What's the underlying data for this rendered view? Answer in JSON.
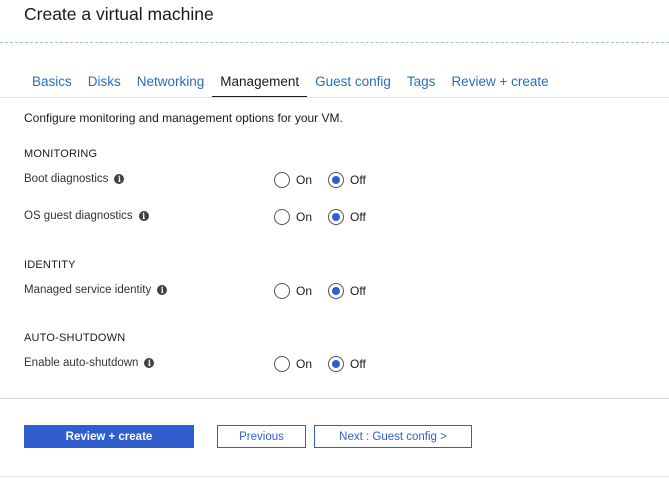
{
  "page_title": "Create a virtual machine",
  "tabs": [
    "Basics",
    "Disks",
    "Networking",
    "Management",
    "Guest config",
    "Tags",
    "Review + create"
  ],
  "intro": "Configure monitoring and management options for your VM.",
  "sections": {
    "monitoring": "MONITORING",
    "identity": "IDENTITY",
    "autoshutdown": "AUTO-SHUTDOWN"
  },
  "rows": [
    {
      "label": "Boot diagnostics",
      "on": "On",
      "off": "Off",
      "selected": "Off"
    },
    {
      "label": "OS guest diagnostics",
      "on": "On",
      "off": "Off",
      "selected": "Off"
    },
    {
      "label": "Managed service identity",
      "on": "On",
      "off": "Off",
      "selected": "Off"
    },
    {
      "label": "Enable auto-shutdown",
      "on": "On",
      "off": "Off",
      "selected": "Off"
    }
  ],
  "info_glyph": "i",
  "buttons": {
    "review_create": "Review + create",
    "previous": "Previous",
    "next": "Next : Guest config >"
  },
  "colors": {
    "accent": "#2f5fcf",
    "tab_link": "#2a6ebb"
  }
}
